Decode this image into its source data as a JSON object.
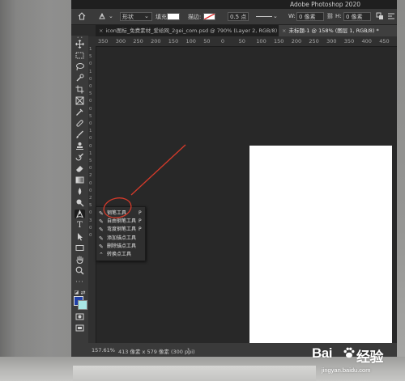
{
  "app": {
    "title": "Adobe Photoshop 2020"
  },
  "options_bar": {
    "mode": "形状",
    "fill_label": "填充:",
    "stroke_label": "描边:",
    "stroke_width": "0.5 点",
    "w_label": "W:",
    "w_value": "0 像素",
    "h_label": "H:",
    "h_value": "0 像素"
  },
  "tabs": [
    {
      "label": "icon图标_免费素材_爱给网_2gei_com.psd @ 790% (Layer 2, RGB/8)",
      "active": false
    },
    {
      "label": "未标题-1 @ 158% (图层 1, RGB/8) *",
      "active": true
    }
  ],
  "ruler_top": [
    "350",
    "300",
    "250",
    "200",
    "150",
    "100",
    "50",
    "0",
    "50",
    "100",
    "150",
    "200",
    "250",
    "300",
    "350",
    "400",
    "450"
  ],
  "ruler_left": [
    "1",
    "5",
    "0",
    "1",
    "0",
    "0",
    "5",
    "0",
    "0",
    "5",
    "0",
    "1",
    "0",
    "0",
    "1",
    "5",
    "0",
    "2",
    "0",
    "0",
    "2",
    "5",
    "0",
    "3",
    "0",
    "0"
  ],
  "pen_flyout": [
    {
      "label": "钢笔工具",
      "shortcut": "P",
      "icon": "pen-icon"
    },
    {
      "label": "自由钢笔工具",
      "shortcut": "P",
      "icon": "freeform-pen-icon"
    },
    {
      "label": "弯度钢笔工具",
      "shortcut": "P",
      "icon": "curvature-pen-icon"
    },
    {
      "label": "添加锚点工具",
      "shortcut": "",
      "icon": "add-anchor-icon"
    },
    {
      "label": "删除锚点工具",
      "shortcut": "",
      "icon": "delete-anchor-icon"
    },
    {
      "label": "转换点工具",
      "shortcut": "",
      "icon": "convert-point-icon"
    }
  ],
  "colors": {
    "foreground": "#1f3fa7",
    "background": "#a9e7e6",
    "annotation": "#d63a2a"
  },
  "status": {
    "zoom": "157.61%",
    "doc_info": "413 像素 x 579 像素 (300 ppi)"
  },
  "watermark": {
    "brand": "Bai经验",
    "url": "jingyan.baidu.com"
  }
}
